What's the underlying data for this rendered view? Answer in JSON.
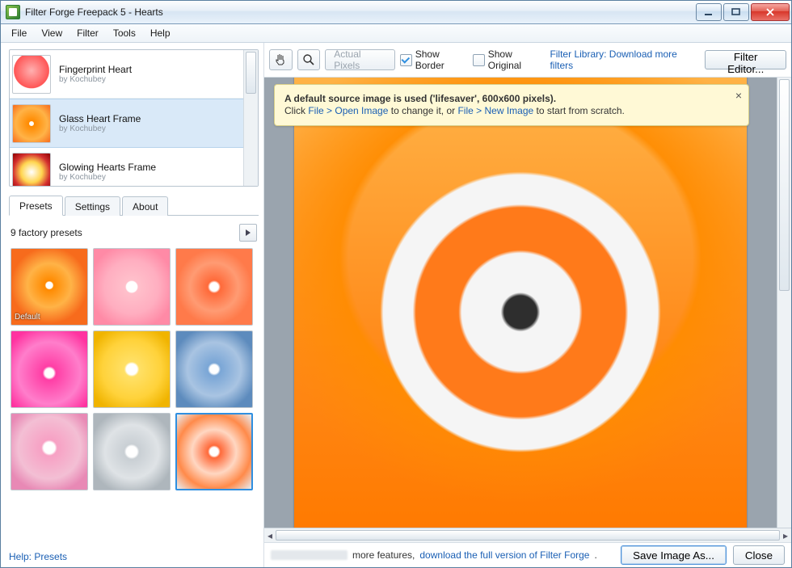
{
  "window": {
    "title": "Filter Forge Freepack 5 - Hearts"
  },
  "menus": [
    "File",
    "View",
    "Filter",
    "Tools",
    "Help"
  ],
  "filters": [
    {
      "name": "Fingerprint Heart",
      "author": "by Kochubey"
    },
    {
      "name": "Glass Heart Frame",
      "author": "by Kochubey"
    },
    {
      "name": "Glowing Hearts Frame",
      "author": "by Kochubey"
    }
  ],
  "tabs": {
    "items": [
      "Presets",
      "Settings",
      "About"
    ],
    "active": 0
  },
  "presets": {
    "count_label": "9 factory presets",
    "default_label": "Default"
  },
  "left_footer": {
    "help_link": "Help: Presets"
  },
  "toolbar": {
    "actual_pixels": "Actual Pixels",
    "show_border": "Show Border",
    "show_original": "Show Original",
    "library_link_1": "Filter Library: ",
    "library_link_2": "Download more filters",
    "filter_editor": "Filter Editor..."
  },
  "tip": {
    "line1_a": "A default source image is used ('lifesaver', 600x600 pixels).",
    "line2_a": "Click ",
    "line2_link1": "File > Open Image",
    "line2_b": " to change it, or ",
    "line2_link2": "File > New Image",
    "line2_c": " to start from scratch."
  },
  "footer": {
    "text_mid": " more features, ",
    "link": "download the full version of Filter Forge",
    "period": ".",
    "save_btn": "Save Image As...",
    "close_btn": "Close"
  }
}
